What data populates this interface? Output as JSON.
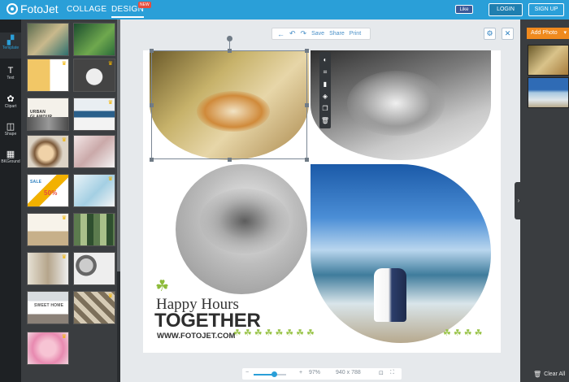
{
  "app": {
    "logo": "FotoJet",
    "nav": {
      "collage": "COLLAGE",
      "design": "DESIGN",
      "new_badge": "NEW"
    },
    "fb_like": "Like",
    "login": "LOGIN",
    "signup": "SIGN UP"
  },
  "tools": [
    {
      "label": "Template",
      "icon": "template-icon",
      "glyph": "▞"
    },
    {
      "label": "Text",
      "icon": "text-icon",
      "glyph": "T"
    },
    {
      "label": "Clipart",
      "icon": "clipart-icon",
      "glyph": "✿"
    },
    {
      "label": "Shape",
      "icon": "shape-icon",
      "glyph": "◫"
    },
    {
      "label": "BKGround",
      "icon": "background-icon",
      "glyph": "▦"
    }
  ],
  "thumbnails": {
    "urban": "URBAN GLAMOUR",
    "sale": "SALE",
    "sale_pct": "50%",
    "sweet_home": "SWEET HOME"
  },
  "editor_toolbar": {
    "share": "Share",
    "save": "Save",
    "print": "Print"
  },
  "canvas": {
    "headline_1": "Happy Hours",
    "headline_2": "TOGETHER",
    "website": "WWW.FOTOJET.COM"
  },
  "zoom": {
    "percent": "97%",
    "level": 0.62,
    "size": "940 x 788",
    "minus": "−",
    "plus": "+"
  },
  "right_panel": {
    "add_photo": "Add Photo",
    "clear_all": "Clear All"
  },
  "colors": {
    "brand": "#2a9fd8",
    "accent": "#f08a1e",
    "clover": "#8dbb3a"
  }
}
